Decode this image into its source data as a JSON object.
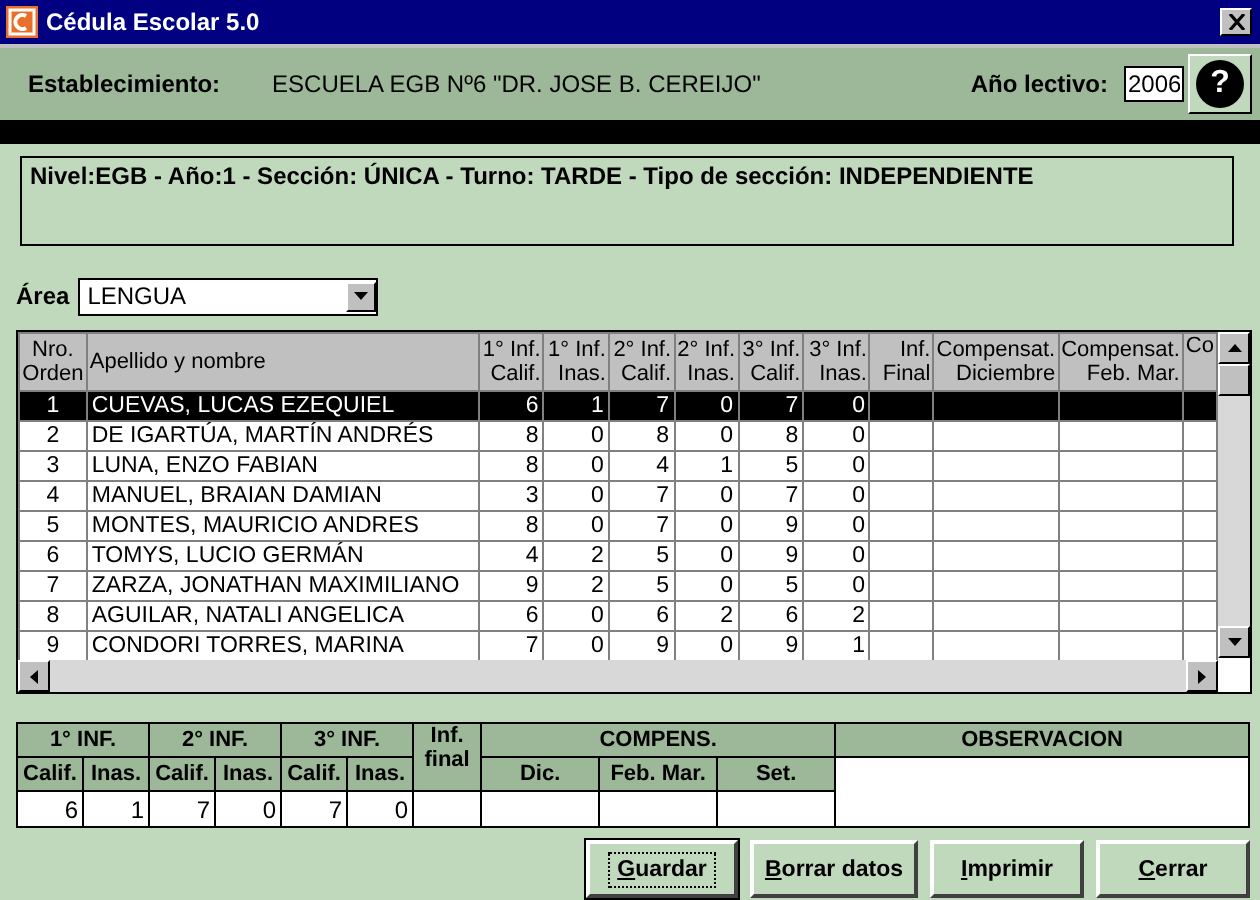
{
  "window": {
    "title": "Cédula Escolar 5.0"
  },
  "header": {
    "establishment_label": "Establecimiento:",
    "establishment": "ESCUELA EGB Nº6 \"DR. JOSE B. CEREIJO\"",
    "year_label": "Año lectivo:",
    "year": "2006",
    "help_button": "?"
  },
  "info": "Nivel:EGB - Año:1 - Sección: ÚNICA - Turno: TARDE - Tipo de sección: INDEPENDIENTE",
  "area": {
    "label": "Área",
    "value": "LENGUA"
  },
  "grid": {
    "columns": [
      {
        "label": "Nro.\nOrden"
      },
      {
        "label": "Apellido y nombre"
      },
      {
        "label": "1° Inf.\nCalif."
      },
      {
        "label": "1° Inf.\nInas."
      },
      {
        "label": "2° Inf.\nCalif."
      },
      {
        "label": "2° Inf.\nInas."
      },
      {
        "label": "3° Inf.\nCalif."
      },
      {
        "label": "3° Inf.\nInas."
      },
      {
        "label": "Inf.\nFinal"
      },
      {
        "label": "Compensat.\nDiciembre"
      },
      {
        "label": "Compensat.\nFeb. Mar."
      },
      {
        "label": "Co"
      }
    ],
    "rows": [
      {
        "selected": true,
        "cells": [
          "1",
          "CUEVAS, LUCAS EZEQUIEL",
          "6",
          "1",
          "7",
          "0",
          "7",
          "0"
        ]
      },
      {
        "selected": false,
        "cells": [
          "2",
          "DE IGARTÚA, MARTÍN ANDRÉS",
          "8",
          "0",
          "8",
          "0",
          "8",
          "0"
        ]
      },
      {
        "selected": false,
        "cells": [
          "3",
          "LUNA, ENZO FABIAN",
          "8",
          "0",
          "4",
          "1",
          "5",
          "0"
        ]
      },
      {
        "selected": false,
        "cells": [
          "4",
          "MANUEL, BRAIAN DAMIAN",
          "3",
          "0",
          "7",
          "0",
          "7",
          "0"
        ]
      },
      {
        "selected": false,
        "cells": [
          "5",
          "MONTES, MAURICIO ANDRES",
          "8",
          "0",
          "7",
          "0",
          "9",
          "0"
        ]
      },
      {
        "selected": false,
        "cells": [
          "6",
          "TOMYS, LUCIO GERMÁN",
          "4",
          "2",
          "5",
          "0",
          "9",
          "0"
        ]
      },
      {
        "selected": false,
        "cells": [
          "7",
          "ZARZA, JONATHAN MAXIMILIANO",
          "9",
          "2",
          "5",
          "0",
          "5",
          "0"
        ]
      },
      {
        "selected": false,
        "cells": [
          "8",
          "AGUILAR, NATALI  ANGELICA",
          "6",
          "0",
          "6",
          "2",
          "6",
          "2"
        ]
      },
      {
        "selected": false,
        "cells": [
          "9",
          "CONDORI TORRES, MARINA",
          "7",
          "0",
          "9",
          "0",
          "9",
          "1"
        ]
      }
    ]
  },
  "summary": {
    "groups": [
      {
        "label": "1° INF.",
        "subcolumns": [
          "Calif.",
          "Inas."
        ],
        "values": [
          "6",
          "1"
        ]
      },
      {
        "label": "2° INF.",
        "subcolumns": [
          "Calif.",
          "Inas."
        ],
        "values": [
          "7",
          "0"
        ]
      },
      {
        "label": "3° INF.",
        "subcolumns": [
          "Calif.",
          "Inas."
        ],
        "values": [
          "7",
          "0"
        ]
      },
      {
        "label": "Inf.\nfinal"
      },
      {
        "label": "COMPENS.",
        "subcolumns": [
          "Dic.",
          "Feb. Mar.",
          "Set."
        ]
      }
    ],
    "observation_label": "OBSERVACION"
  },
  "buttons": [
    {
      "label": "Guardar",
      "default": true
    },
    {
      "label": "Borrar datos",
      "default": false
    },
    {
      "label": "Imprimir",
      "default": false
    },
    {
      "label": "Cerrar",
      "default": false
    }
  ]
}
